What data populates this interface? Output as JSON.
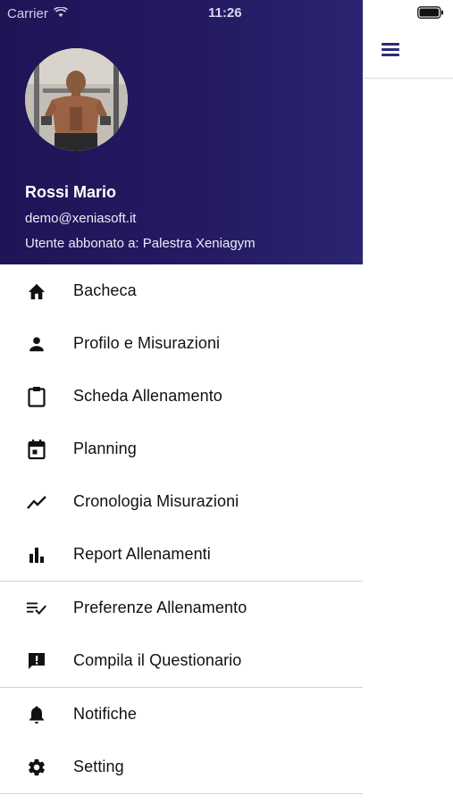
{
  "status_bar": {
    "carrier": "Carrier",
    "time": "11:26",
    "wifi_icon": "wifi-icon",
    "battery_icon": "battery-icon"
  },
  "toolbar": {
    "menu_icon": "hamburger-menu-icon",
    "accent_color": "#2e2a78"
  },
  "profile": {
    "name": "Rossi Mario",
    "email": "demo@xeniasoft.it",
    "subscription": "Utente abbonato a: Palestra Xeniagym",
    "header_color": "#221760"
  },
  "menu": {
    "items": [
      {
        "label": "Bacheca",
        "icon": "home-icon"
      },
      {
        "label": "Profilo e Misurazioni",
        "icon": "person-icon"
      },
      {
        "label": "Scheda Allenamento",
        "icon": "clipboard-icon"
      },
      {
        "label": "Planning",
        "icon": "calendar-icon"
      },
      {
        "label": "Cronologia Misurazioni",
        "icon": "trending-line-icon"
      },
      {
        "label": "Report Allenamenti",
        "icon": "bar-chart-icon"
      },
      {
        "label": "Preferenze Allenamento",
        "icon": "playlist-check-icon"
      },
      {
        "label": "Compila il Questionario",
        "icon": "feedback-icon"
      },
      {
        "label": "Notifiche",
        "icon": "bell-icon"
      },
      {
        "label": "Setting",
        "icon": "gear-icon"
      }
    ]
  }
}
